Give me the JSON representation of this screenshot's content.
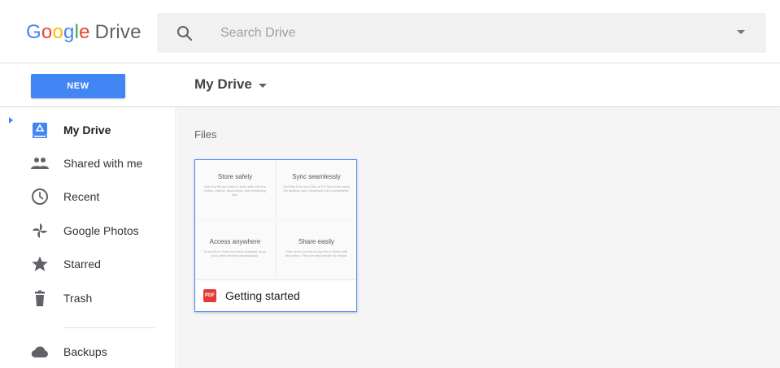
{
  "header": {
    "logo_letters": [
      "G",
      "o",
      "o",
      "g",
      "l",
      "e"
    ],
    "logo_product": "Drive",
    "search_placeholder": "Search Drive",
    "search_icon": "search-icon",
    "search_options_icon": "caret-down-icon"
  },
  "toolbar": {
    "new_label": "NEW",
    "breadcrumb": "My Drive",
    "breadcrumb_icon": "caret-down-icon"
  },
  "sidebar": {
    "items": [
      {
        "label": "My Drive",
        "icon": "my-drive-icon",
        "active": true
      },
      {
        "label": "Shared with me",
        "icon": "people-icon",
        "active": false
      },
      {
        "label": "Recent",
        "icon": "clock-icon",
        "active": false
      },
      {
        "label": "Google Photos",
        "icon": "photos-pinwheel-icon",
        "active": false
      },
      {
        "label": "Starred",
        "icon": "star-icon",
        "active": false
      },
      {
        "label": "Trash",
        "icon": "trash-icon",
        "active": false
      },
      {
        "label": "Backups",
        "icon": "cloud-icon",
        "active": false
      }
    ]
  },
  "main": {
    "section_label": "Files",
    "files": [
      {
        "name": "Getting started",
        "type_badge": "PDF",
        "thumbnail": {
          "cells": [
            {
              "title": "Store safely",
              "body": "Add any file you want to keep safe with the button: photos, documents, and everything else."
            },
            {
              "title": "Sync seamlessly",
              "body": "Get files from your Mac or PC into Drive using the desktop app. Download it at g.co/getdrive."
            },
            {
              "title": "Access anywhere",
              "body": "Every file in Drive becomes available on all your other devices automatically."
            },
            {
              "title": "Share easily",
              "body": "Give others access to any file or folder with the button. Files are kept private by default."
            }
          ]
        }
      }
    ]
  },
  "colors": {
    "accent": "#4285f4",
    "pdf_red": "#e53935",
    "sidebar_icon": "#5f6368"
  }
}
